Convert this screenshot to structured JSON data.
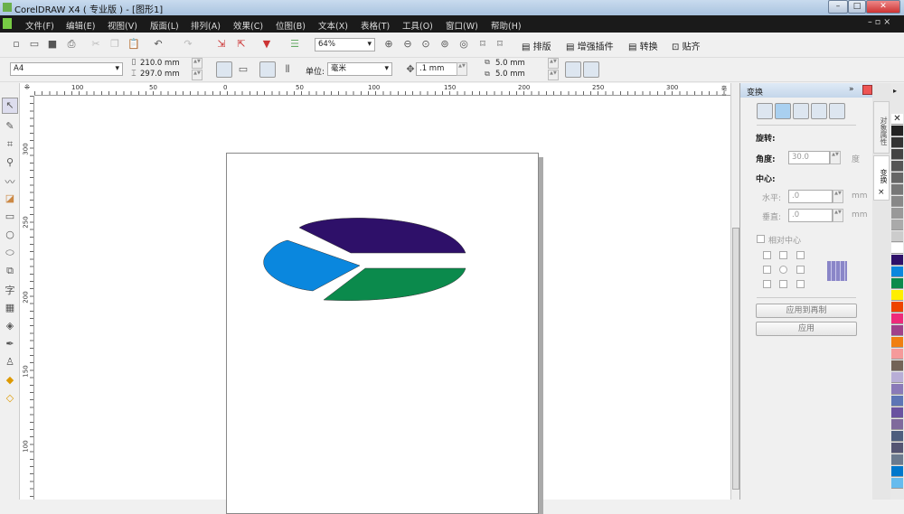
{
  "title": "CorelDRAW X4 ( 专业版 ) - [图形1]",
  "menu": [
    "文件(F)",
    "编辑(E)",
    "视图(V)",
    "版面(L)",
    "排列(A)",
    "效果(C)",
    "位图(B)",
    "文本(X)",
    "表格(T)",
    "工具(O)",
    "窗口(W)",
    "帮助(H)"
  ],
  "toolbar": {
    "zoom": "64%",
    "plugins": [
      "排版",
      "增强插件",
      "转换",
      "贴齐"
    ]
  },
  "propbar": {
    "paper": "A4",
    "width": "210.0 mm",
    "height": "297.0 mm",
    "unit_label": "单位:",
    "unit": "毫米",
    "nudge": ".1 mm",
    "dup_x": "5.0 mm",
    "dup_y": "5.0 mm"
  },
  "ruler": {
    "h": [
      "100",
      "50",
      "0",
      "50",
      "100",
      "150",
      "200",
      "250",
      "300"
    ],
    "unit": "毫米",
    "v": [
      "300",
      "250",
      "200",
      "150",
      "100"
    ]
  },
  "panel": {
    "title": "变换",
    "section": "旋转:",
    "angle_label": "角度:",
    "angle": "30.0",
    "angle_unit": "度",
    "center": "中心:",
    "h_label": "水平:",
    "h_val": ".0",
    "v_label": "垂直:",
    "v_val": ".0",
    "mm": "mm",
    "relative": "相对中心",
    "apply_dup": "应用到再制",
    "apply": "应用"
  },
  "tabs": {
    "obj": "对象属性",
    "transform": "变换"
  },
  "chart_colors": {
    "top": "#2e1069",
    "left": "#0a87de",
    "bottom": "#0b8a4c"
  },
  "palette": [
    "#222222",
    "#333333",
    "#444444",
    "#555555",
    "#666666",
    "#777777",
    "#888888",
    "#999999",
    "#aaaaaa",
    "#cccccc",
    "#ffffff",
    "#2e1069",
    "#0a87de",
    "#0b8a4c",
    "#ffee00",
    "#ee4400",
    "#ee2a7b",
    "#a0418a",
    "#f07f12",
    "#f59a9a",
    "#736357",
    "#b8aed6",
    "#8a7ab8",
    "#5d75b5",
    "#6a53a0",
    "#7f6a9c",
    "#4e5e7e",
    "#555573",
    "#6b7a8e",
    "#0077cc",
    "#66bbee"
  ]
}
